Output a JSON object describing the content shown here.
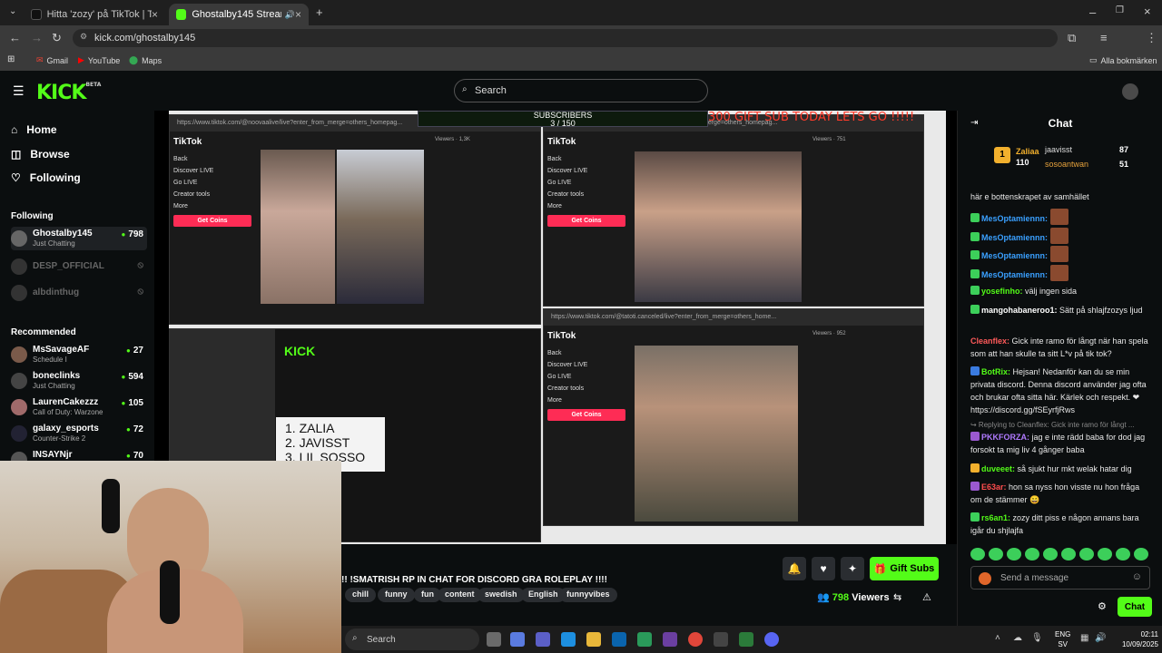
{
  "browser": {
    "tabs": [
      {
        "title": "Hitta 'zozy' på TikTok | TikTok-s"
      },
      {
        "title": "Ghostalby145 Stream - Wa"
      }
    ],
    "url": "kick.com/ghostalby145",
    "bookmarks": [
      "Gmail",
      "YouTube",
      "Maps"
    ],
    "all_bookmarks": "Alla bokmärken",
    "profile_initial": "M"
  },
  "kick": {
    "logo": "KICK",
    "logo_sup": "BETA",
    "search_placeholder": "Search"
  },
  "sidebar": {
    "nav": [
      {
        "label": "Home"
      },
      {
        "label": "Browse"
      },
      {
        "label": "Following"
      }
    ],
    "following_heading": "Following",
    "following": [
      {
        "name": "Ghostalby145",
        "sub": "Just Chatting",
        "count": "798"
      },
      {
        "name": "DESP_OFFICIAL"
      },
      {
        "name": "albdinthug"
      }
    ],
    "recommended_heading": "Recommended",
    "recommended": [
      {
        "name": "MsSavageAF",
        "sub": "Schedule I",
        "count": "27"
      },
      {
        "name": "boneclinks",
        "sub": "Just Chatting",
        "count": "594"
      },
      {
        "name": "LaurenCakezzz",
        "sub": "Call of Duty: Warzone",
        "count": "105"
      },
      {
        "name": "galaxy_esports",
        "sub": "Counter-Strike 2",
        "count": "72"
      },
      {
        "name": "INSAYNjr",
        "count": "70"
      }
    ]
  },
  "stream": {
    "subs_label": "SUBSCRIBERS",
    "subs_value": "3 / 150",
    "gift_banner": "300  GIFT SUB TODAY LETS GO !!!!!",
    "panes": [
      {
        "url": "https://www.tiktok.com/@noovaalive/live?enter_from_merge=others_homepag...",
        "viewers": "Viewers · 1,3K"
      },
      {
        "url": "https://www.tiktok.com/@zozysworld/live?enter_from_merge=others_homepag...",
        "viewers": "Viewers · 751"
      },
      {
        "url": "https://www.tiktok.com/@tatoti.canceled/live?enter_from_merge=others_home...",
        "viewers": "Viewers · 952"
      }
    ],
    "tiktok_menu": [
      "TikTok",
      "Back",
      "Discover LIVE",
      "Go LIVE",
      "Creator tools",
      "More"
    ],
    "get_coins": "Get Coins",
    "ranking": [
      "1. ZALIA",
      "2. JAVISST",
      "3. LIL SOSSO"
    ]
  },
  "info": {
    "title": "!! !SMATRISH RP IN CHAT FOR DISCORD GRA ROLEPLAY !!!!",
    "tags": [
      "chill",
      "funny",
      "fun",
      "content",
      "swedish",
      "English",
      "funnyvibes"
    ],
    "gift_subs": "Gift Subs",
    "viewers_count": "798",
    "viewers_label": "Viewers"
  },
  "chat": {
    "title": "Chat",
    "leaderboard": [
      {
        "name": "Zaliaa",
        "value": "110",
        "rank": "1"
      },
      {
        "name": "jaavisst",
        "value": "87"
      },
      {
        "name": "sosoantwan",
        "value": "51"
      }
    ],
    "messages": [
      {
        "user": "",
        "text": "här e bottenskrapet av samhället"
      },
      {
        "user": "MesOptamiennn:",
        "text": ""
      },
      {
        "user": "MesOptamiennn:",
        "text": ""
      },
      {
        "user": "MesOptamiennn:",
        "text": ""
      },
      {
        "user": "MesOptamiennn:",
        "text": ""
      },
      {
        "user": "yosefinho:",
        "text": " välj ingen sida"
      },
      {
        "user": "mangohabaneroo1:",
        "text": " Sätt på shlajfzozys ljud"
      },
      {
        "user": "Cleanflex:",
        "text": " Gick inte ramo för långt när han spela som att han skulle ta sitt L*v på tik tok?"
      },
      {
        "user": "BotRix:",
        "text": " Hejsan! Nedanför kan du se min privata discord. Denna discord använder jag ofta och brukar ofta sitta här. Kärlek och respekt. ❤ https://discord.gg/fSEyrfjRws"
      },
      {
        "user": "",
        "text": "↪ Replying to Cleanflex: Gick inte ramo för långt ..."
      },
      {
        "user": "PKKFORZA:",
        "text": " jag e inte rädd baba for dod jag forsokt ta mig liv 4 gånger baba"
      },
      {
        "user": "duveeet:",
        "text": " så sjukt hur mkt welak hatar dig"
      },
      {
        "user": "E63ar:",
        "text": " hon sa nyss hon visste nu hon fråga om de stämmer 😄"
      },
      {
        "user": "rs6an1:",
        "text": " zozy ditt piss e någon annans bara igår du shjlajfa"
      }
    ],
    "input_placeholder": "Send a message",
    "send_label": "Chat"
  },
  "taskbar": {
    "search": "Search",
    "lang": "ENG",
    "lang_sub": "SV",
    "time": "02:11",
    "date": "10/09/2025"
  },
  "colors": {
    "accent": "#53fc18",
    "tiktok": "#fe2c55",
    "banner": "#ff3b2a"
  }
}
